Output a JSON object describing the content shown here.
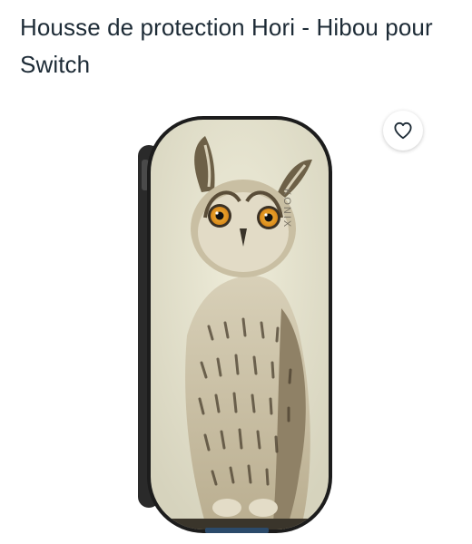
{
  "product": {
    "title": "Housse de protection Hori - Hibou pour Switch",
    "brand_print": "KONIX",
    "image_icon": "owl-switch-case"
  },
  "wishlist": {
    "icon": "heart-outline-icon"
  },
  "colors": {
    "title_text": "#1d2b36",
    "case_border": "#1c1c1c",
    "case_background": "#e6e3cf"
  }
}
